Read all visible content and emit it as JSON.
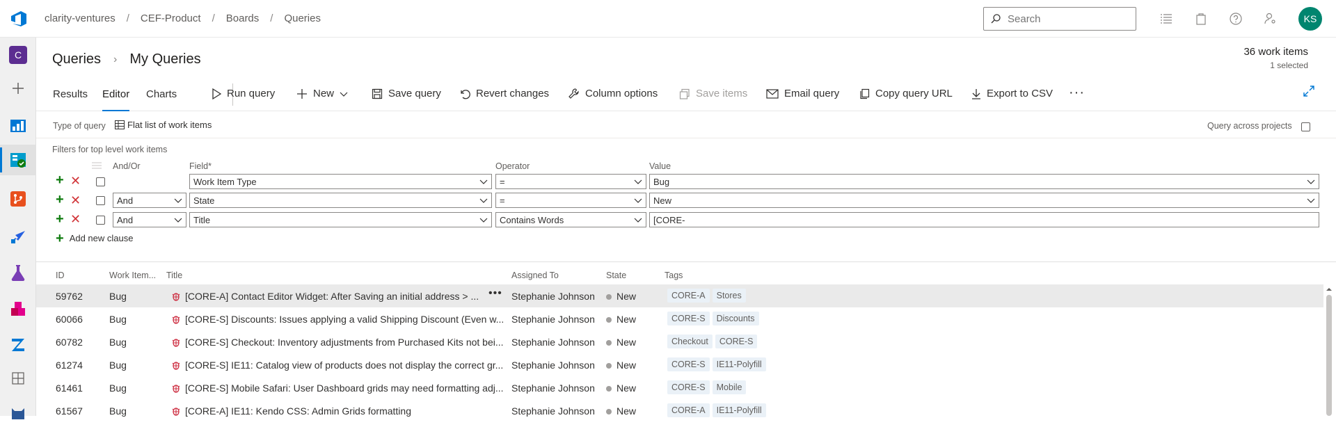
{
  "topbar": {
    "breadcrumbs": [
      "clarity-ventures",
      "CEF-Product",
      "Boards",
      "Queries"
    ],
    "search_placeholder": "Search",
    "avatar_initials": "KS",
    "avatar_color": "#00856f"
  },
  "rail": {
    "org_initial": "C",
    "items": [
      "add-icon",
      "overview-icon",
      "boards-icon",
      "repos-icon",
      "pipelines-icon",
      "test-plans-icon",
      "artifacts-icon",
      "extension-icon",
      "grid-icon",
      "cat-icon"
    ]
  },
  "page": {
    "root": "Queries",
    "current": "My Queries",
    "count": "36 work items",
    "selected": "1 selected"
  },
  "toolbar": {
    "tabs": [
      "Results",
      "Editor",
      "Charts"
    ],
    "active_tab": "Editor",
    "commands": {
      "run": "Run query",
      "new": "New",
      "save": "Save query",
      "revert": "Revert changes",
      "columns": "Column options",
      "save_items": "Save items",
      "email": "Email query",
      "copy_url": "Copy query URL",
      "export": "Export to CSV"
    }
  },
  "editor": {
    "type_label": "Type of query",
    "type_value": "Flat list of work items",
    "across_projects": "Query across projects",
    "filters_label": "Filters for top level work items",
    "col_andor": "And/Or",
    "col_field": "Field*",
    "col_operator": "Operator",
    "col_value": "Value",
    "clauses": [
      {
        "andor": "",
        "field": "Work Item Type",
        "operator": "=",
        "value": "Bug"
      },
      {
        "andor": "And",
        "field": "State",
        "operator": "=",
        "value": "New"
      },
      {
        "andor": "And",
        "field": "Title",
        "operator": "Contains Words",
        "value": "[CORE-"
      }
    ],
    "add_clause": "Add new clause"
  },
  "grid": {
    "headers": {
      "id": "ID",
      "type": "Work Item...",
      "title": "Title",
      "assigned": "Assigned To",
      "state": "State",
      "tags": "Tags"
    },
    "rows": [
      {
        "id": "59762",
        "type": "Bug",
        "title": "[CORE-A] Contact Editor Widget: After Saving an initial address > ...",
        "assigned": "Stephanie Johnson",
        "state": "New",
        "tags": [
          "CORE-A",
          "Stores"
        ]
      },
      {
        "id": "60066",
        "type": "Bug",
        "title": "[CORE-S] Discounts: Issues applying a valid Shipping Discount (Even w...",
        "assigned": "Stephanie Johnson",
        "state": "New",
        "tags": [
          "CORE-S",
          "Discounts"
        ]
      },
      {
        "id": "60782",
        "type": "Bug",
        "title": "[CORE-S] Checkout: Inventory adjustments from Purchased Kits not bei...",
        "assigned": "Stephanie Johnson",
        "state": "New",
        "tags": [
          "Checkout",
          "CORE-S"
        ]
      },
      {
        "id": "61274",
        "type": "Bug",
        "title": "[CORE-S] IE11: Catalog view of products does not display the correct gr...",
        "assigned": "Stephanie Johnson",
        "state": "New",
        "tags": [
          "CORE-S",
          "IE11-Polyfill"
        ]
      },
      {
        "id": "61461",
        "type": "Bug",
        "title": "[CORE-S] Mobile Safari: User Dashboard grids may need formatting adj...",
        "assigned": "Stephanie Johnson",
        "state": "New",
        "tags": [
          "CORE-S",
          "Mobile"
        ]
      },
      {
        "id": "61567",
        "type": "Bug",
        "title": "[CORE-A] IE11: Kendo CSS: Admin Grids formatting",
        "assigned": "Stephanie Johnson",
        "state": "New",
        "tags": [
          "CORE-A",
          "IE11-Polyfill"
        ]
      }
    ]
  }
}
